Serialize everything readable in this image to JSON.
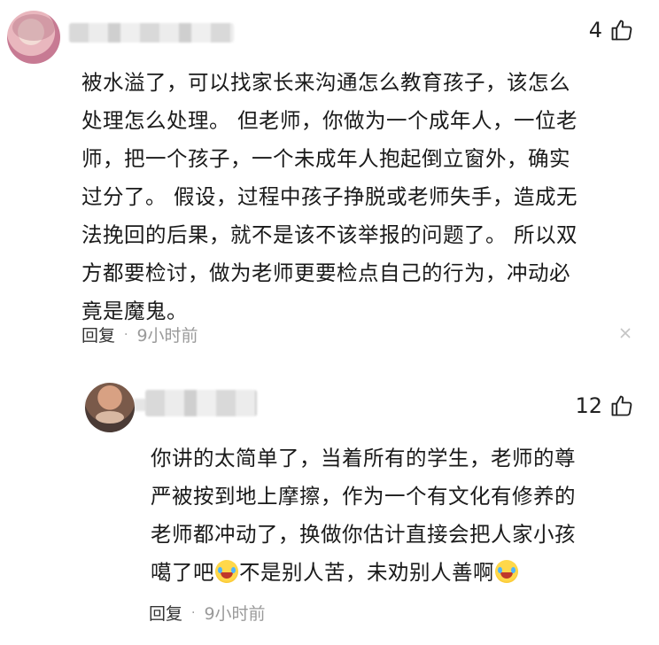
{
  "comment": {
    "likes": "4",
    "lines": [
      "被水溢了，可以找家长来沟通怎么教育孩子，该怎么",
      "处理怎么处理。 但老师，你做为一个成年人，一位老",
      "师，把一个孩子，一个未成年人抱起倒立窗外，确实",
      "过分了。 假设，过程中孩子挣脱或老师失手，造成无",
      "法挽回的后果，就不是该不该举报的问题了。 所以双",
      "方都要检讨，做为老师更要检点自己的行为，冲动必",
      "竟是魔鬼。"
    ],
    "reply_label": "回复",
    "separator": "·",
    "time": "9小时前"
  },
  "reply": {
    "likes": "12",
    "lines": [
      "你讲的太简单了，当着所有的学生，老师的尊",
      "严被按到地上摩擦，作为一个有文化有修养的",
      "老师都冲动了，换做你估计直接会把人家小孩"
    ],
    "line4_a": "噶了吧",
    "line4_b": "不是别人苦，未劝别人善啊",
    "reply_label": "回复",
    "separator": "·",
    "time": "9小时前"
  },
  "icons": {
    "like": "thumbs-up-icon",
    "close": "close-icon",
    "emoji": "crying-laughing-emoji"
  }
}
